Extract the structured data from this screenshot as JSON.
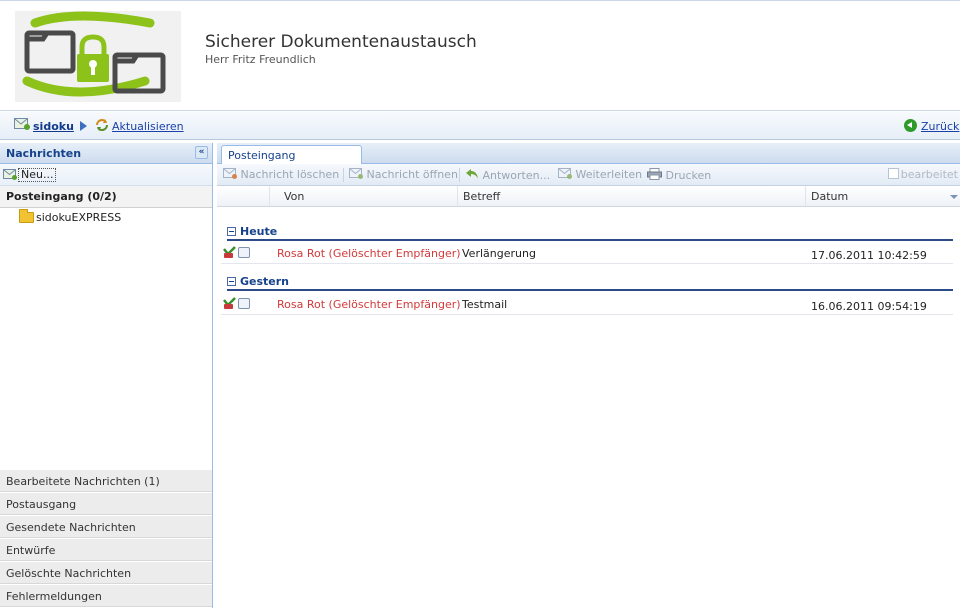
{
  "header": {
    "title": "Sicherer Dokumentenaustausch",
    "subtitle": "Herr Fritz Freundlich"
  },
  "breadcrumb": {
    "home_label": "sidoku",
    "refresh_label": "Aktualisieren",
    "back_label": "Zurück"
  },
  "sidebar": {
    "title": "Nachrichten",
    "new_label": "Neu...",
    "inbox_label": "Posteingang (0/2)",
    "folders": [
      "sidokuEXPRESS"
    ],
    "sections": [
      "Bearbeitete Nachrichten (1)",
      "Postausgang",
      "Gesendete Nachrichten",
      "Entwürfe",
      "Gelöschte Nachrichten",
      "Fehlermeldungen"
    ]
  },
  "main": {
    "tab_label": "Posteingang",
    "toolbar": {
      "delete": "Nachricht löschen",
      "open": "Nachricht öffnen",
      "reply": "Antworten...",
      "forward": "Weiterleiten",
      "print": "Drucken",
      "edited_checkbox": "bearbeitet"
    },
    "columns": {
      "from": "Von",
      "subject": "Betreff",
      "date": "Datum"
    },
    "groups": [
      {
        "label": "Heute",
        "rows": [
          {
            "from": "Rosa Rot (Gelöschter Empfänger)",
            "subject": "Verlängerung",
            "date": "17.06.2011 10:42:59"
          }
        ]
      },
      {
        "label": "Gestern",
        "rows": [
          {
            "from": "Rosa Rot (Gelöschter Empfänger)",
            "subject": "Testmail",
            "date": "16.06.2011 09:54:19"
          }
        ]
      }
    ]
  },
  "colors": {
    "accent": "#15428b",
    "logo_green": "#7ab317",
    "sender_red": "#d23a3a"
  }
}
